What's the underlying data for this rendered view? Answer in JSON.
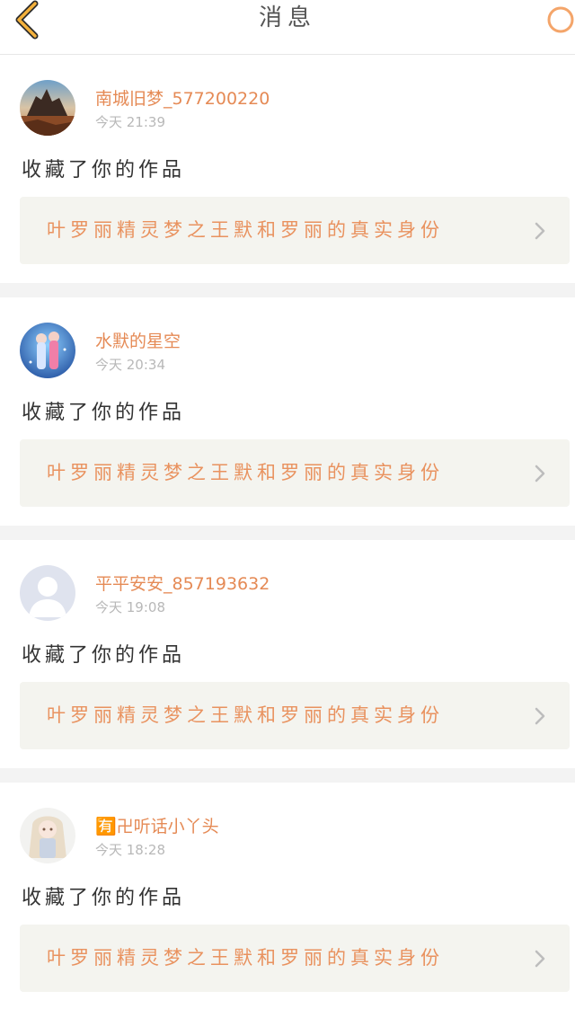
{
  "header": {
    "title": "消息",
    "back_icon": "chevron-left-icon",
    "search_icon": "search-icon",
    "accent": "#f4b13c"
  },
  "notifications": [
    {
      "username": "南城旧梦_577200220",
      "time": "今天 21:39",
      "message": "收藏了你的作品",
      "work_title": "叶罗丽精灵梦之王默和罗丽的真实身份",
      "avatar": "landscape-avatar"
    },
    {
      "username": "水默的星空",
      "time": "今天 20:34",
      "message": "收藏了你的作品",
      "work_title": "叶罗丽精灵梦之王默和罗丽的真实身份",
      "avatar": "anime-couple-avatar"
    },
    {
      "username": "平平安安_857193632",
      "time": "今天 19:08",
      "message": "收藏了你的作品",
      "work_title": "叶罗丽精灵梦之王默和罗丽的真实身份",
      "avatar": "default-user-avatar"
    },
    {
      "username": "🈶卍听话小丫头",
      "time": "今天 18:28",
      "message": "收藏了你的作品",
      "work_title": "叶罗丽精灵梦之王默和罗丽的真实身份",
      "avatar": "anime-girl-avatar"
    }
  ],
  "colors": {
    "username": "#e58a55",
    "work_title": "#e9925f",
    "card_bg": "#f4f4ef",
    "separator": "#f3f3f3"
  }
}
